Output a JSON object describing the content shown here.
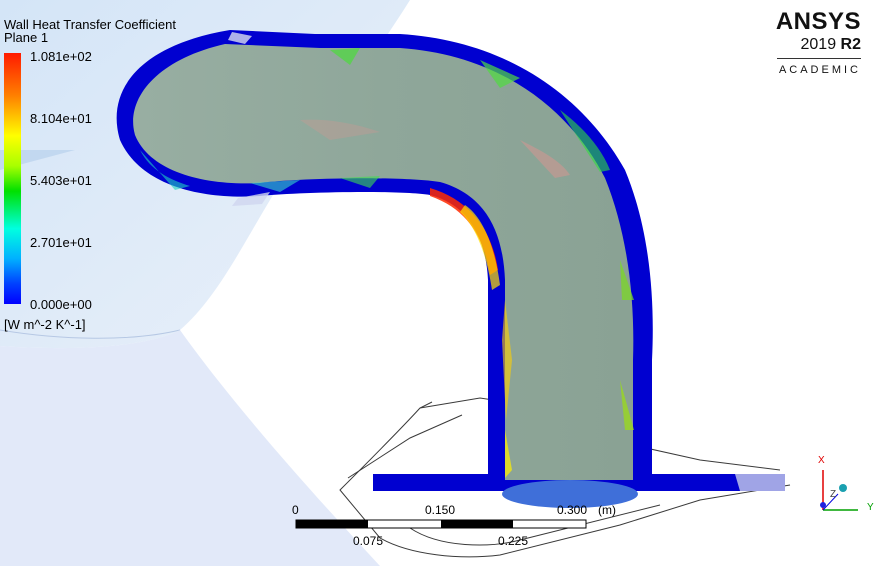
{
  "legend": {
    "title": "Wall Heat Transfer Coefficient",
    "subtitle": "Plane 1",
    "ticks": [
      "1.081e+02",
      "8.104e+01",
      "5.403e+01",
      "2.701e+01",
      "0.000e+00"
    ],
    "units": "[W m^-2 K^-1]"
  },
  "logo": {
    "brand": "ANSYS",
    "version": "2019",
    "release": "R2",
    "edition": "ACADEMIC"
  },
  "scale_bar": {
    "top_labels": [
      "0",
      "0.150",
      "0.300",
      "(m)"
    ],
    "bottom_labels": [
      "0.075",
      "0.225"
    ]
  },
  "triad": {
    "x": "X",
    "y": "Y",
    "z": "Z"
  },
  "colors": {
    "pipe_wall": "#0000d8",
    "pipe_fluid": "#8fa89a",
    "background_body": "#d6e6f7",
    "hot": "#ff2000",
    "cold": "#0000ff"
  }
}
